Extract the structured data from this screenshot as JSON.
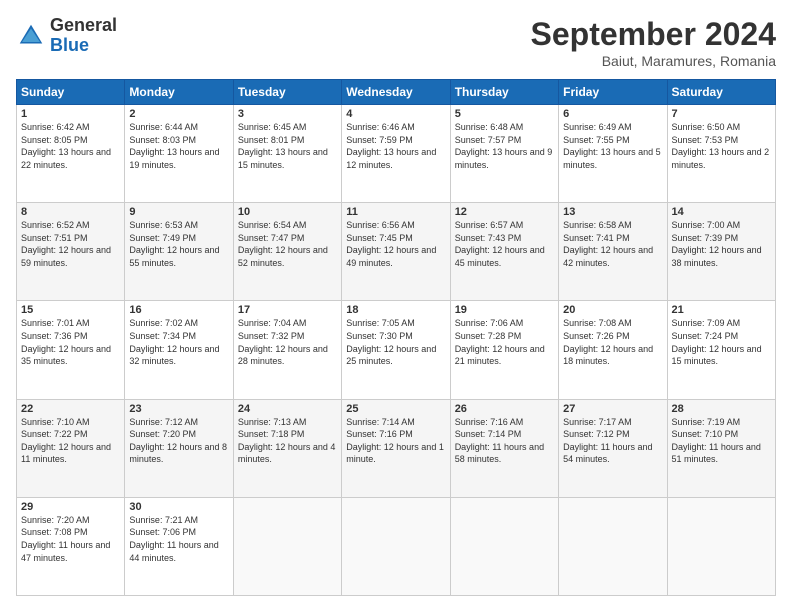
{
  "header": {
    "logo_text_general": "General",
    "logo_text_blue": "Blue",
    "month_title": "September 2024",
    "location": "Baiut, Maramures, Romania"
  },
  "weekdays": [
    "Sunday",
    "Monday",
    "Tuesday",
    "Wednesday",
    "Thursday",
    "Friday",
    "Saturday"
  ],
  "weeks": [
    [
      {
        "day": "1",
        "sunrise": "6:42 AM",
        "sunset": "8:05 PM",
        "daylight": "13 hours and 22 minutes."
      },
      {
        "day": "2",
        "sunrise": "6:44 AM",
        "sunset": "8:03 PM",
        "daylight": "13 hours and 19 minutes."
      },
      {
        "day": "3",
        "sunrise": "6:45 AM",
        "sunset": "8:01 PM",
        "daylight": "13 hours and 15 minutes."
      },
      {
        "day": "4",
        "sunrise": "6:46 AM",
        "sunset": "7:59 PM",
        "daylight": "13 hours and 12 minutes."
      },
      {
        "day": "5",
        "sunrise": "6:48 AM",
        "sunset": "7:57 PM",
        "daylight": "13 hours and 9 minutes."
      },
      {
        "day": "6",
        "sunrise": "6:49 AM",
        "sunset": "7:55 PM",
        "daylight": "13 hours and 5 minutes."
      },
      {
        "day": "7",
        "sunrise": "6:50 AM",
        "sunset": "7:53 PM",
        "daylight": "13 hours and 2 minutes."
      }
    ],
    [
      {
        "day": "8",
        "sunrise": "6:52 AM",
        "sunset": "7:51 PM",
        "daylight": "12 hours and 59 minutes."
      },
      {
        "day": "9",
        "sunrise": "6:53 AM",
        "sunset": "7:49 PM",
        "daylight": "12 hours and 55 minutes."
      },
      {
        "day": "10",
        "sunrise": "6:54 AM",
        "sunset": "7:47 PM",
        "daylight": "12 hours and 52 minutes."
      },
      {
        "day": "11",
        "sunrise": "6:56 AM",
        "sunset": "7:45 PM",
        "daylight": "12 hours and 49 minutes."
      },
      {
        "day": "12",
        "sunrise": "6:57 AM",
        "sunset": "7:43 PM",
        "daylight": "12 hours and 45 minutes."
      },
      {
        "day": "13",
        "sunrise": "6:58 AM",
        "sunset": "7:41 PM",
        "daylight": "12 hours and 42 minutes."
      },
      {
        "day": "14",
        "sunrise": "7:00 AM",
        "sunset": "7:39 PM",
        "daylight": "12 hours and 38 minutes."
      }
    ],
    [
      {
        "day": "15",
        "sunrise": "7:01 AM",
        "sunset": "7:36 PM",
        "daylight": "12 hours and 35 minutes."
      },
      {
        "day": "16",
        "sunrise": "7:02 AM",
        "sunset": "7:34 PM",
        "daylight": "12 hours and 32 minutes."
      },
      {
        "day": "17",
        "sunrise": "7:04 AM",
        "sunset": "7:32 PM",
        "daylight": "12 hours and 28 minutes."
      },
      {
        "day": "18",
        "sunrise": "7:05 AM",
        "sunset": "7:30 PM",
        "daylight": "12 hours and 25 minutes."
      },
      {
        "day": "19",
        "sunrise": "7:06 AM",
        "sunset": "7:28 PM",
        "daylight": "12 hours and 21 minutes."
      },
      {
        "day": "20",
        "sunrise": "7:08 AM",
        "sunset": "7:26 PM",
        "daylight": "12 hours and 18 minutes."
      },
      {
        "day": "21",
        "sunrise": "7:09 AM",
        "sunset": "7:24 PM",
        "daylight": "12 hours and 15 minutes."
      }
    ],
    [
      {
        "day": "22",
        "sunrise": "7:10 AM",
        "sunset": "7:22 PM",
        "daylight": "12 hours and 11 minutes."
      },
      {
        "day": "23",
        "sunrise": "7:12 AM",
        "sunset": "7:20 PM",
        "daylight": "12 hours and 8 minutes."
      },
      {
        "day": "24",
        "sunrise": "7:13 AM",
        "sunset": "7:18 PM",
        "daylight": "12 hours and 4 minutes."
      },
      {
        "day": "25",
        "sunrise": "7:14 AM",
        "sunset": "7:16 PM",
        "daylight": "12 hours and 1 minute."
      },
      {
        "day": "26",
        "sunrise": "7:16 AM",
        "sunset": "7:14 PM",
        "daylight": "11 hours and 58 minutes."
      },
      {
        "day": "27",
        "sunrise": "7:17 AM",
        "sunset": "7:12 PM",
        "daylight": "11 hours and 54 minutes."
      },
      {
        "day": "28",
        "sunrise": "7:19 AM",
        "sunset": "7:10 PM",
        "daylight": "11 hours and 51 minutes."
      }
    ],
    [
      {
        "day": "29",
        "sunrise": "7:20 AM",
        "sunset": "7:08 PM",
        "daylight": "11 hours and 47 minutes."
      },
      {
        "day": "30",
        "sunrise": "7:21 AM",
        "sunset": "7:06 PM",
        "daylight": "11 hours and 44 minutes."
      },
      null,
      null,
      null,
      null,
      null
    ]
  ]
}
